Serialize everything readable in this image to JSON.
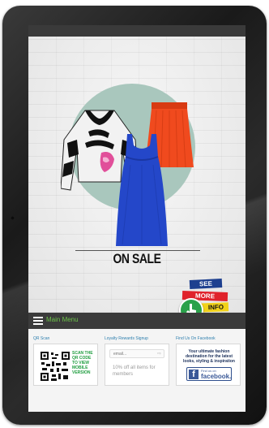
{
  "hero": {
    "headline": "ON SALE",
    "badges": {
      "see": "SEE",
      "more": "MORE",
      "info": "INFO"
    }
  },
  "menu": {
    "label": "Main Menu"
  },
  "footer": {
    "qr": {
      "title": "QR Scan",
      "text": "SCAN THE QR CODE TO VIEW MOBILE VERSION"
    },
    "loyalty": {
      "title": "Loyalty Rewards Signup",
      "email_placeholder": "email...",
      "text": "10% off all items for members"
    },
    "facebook": {
      "title": "Find Us On Facebook",
      "text": "Your ultimate fashion destination for the latest looks, styling & inspiration",
      "button_small": "Find us on",
      "button_big": "facebook."
    }
  },
  "colors": {
    "menu_accent": "#6cc24a",
    "see": "#1d3f8f",
    "more": "#e0222b",
    "info": "#f1d21a",
    "circle": "#a9c7bd"
  }
}
